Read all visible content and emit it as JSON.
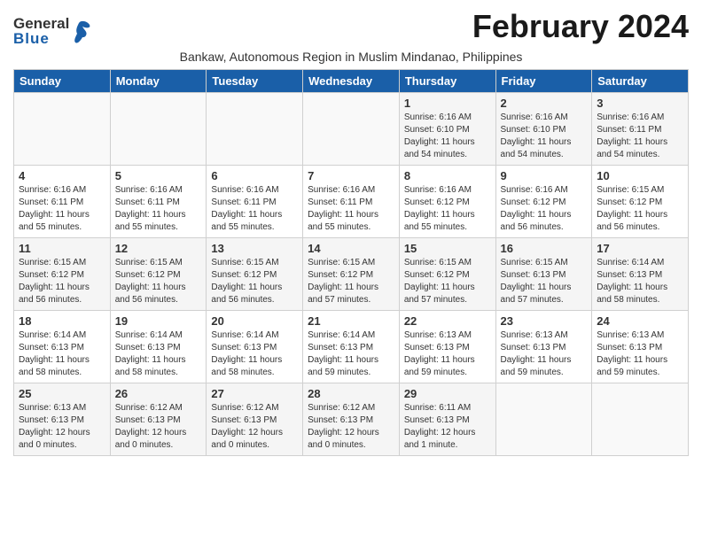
{
  "header": {
    "logo_general": "General",
    "logo_blue": "Blue",
    "month_title": "February 2024",
    "subtitle": "Bankaw, Autonomous Region in Muslim Mindanao, Philippines"
  },
  "weekdays": [
    "Sunday",
    "Monday",
    "Tuesday",
    "Wednesday",
    "Thursday",
    "Friday",
    "Saturday"
  ],
  "weeks": [
    [
      {
        "day": "",
        "info": ""
      },
      {
        "day": "",
        "info": ""
      },
      {
        "day": "",
        "info": ""
      },
      {
        "day": "",
        "info": ""
      },
      {
        "day": "1",
        "info": "Sunrise: 6:16 AM\nSunset: 6:10 PM\nDaylight: 11 hours\nand 54 minutes."
      },
      {
        "day": "2",
        "info": "Sunrise: 6:16 AM\nSunset: 6:10 PM\nDaylight: 11 hours\nand 54 minutes."
      },
      {
        "day": "3",
        "info": "Sunrise: 6:16 AM\nSunset: 6:11 PM\nDaylight: 11 hours\nand 54 minutes."
      }
    ],
    [
      {
        "day": "4",
        "info": "Sunrise: 6:16 AM\nSunset: 6:11 PM\nDaylight: 11 hours\nand 55 minutes."
      },
      {
        "day": "5",
        "info": "Sunrise: 6:16 AM\nSunset: 6:11 PM\nDaylight: 11 hours\nand 55 minutes."
      },
      {
        "day": "6",
        "info": "Sunrise: 6:16 AM\nSunset: 6:11 PM\nDaylight: 11 hours\nand 55 minutes."
      },
      {
        "day": "7",
        "info": "Sunrise: 6:16 AM\nSunset: 6:11 PM\nDaylight: 11 hours\nand 55 minutes."
      },
      {
        "day": "8",
        "info": "Sunrise: 6:16 AM\nSunset: 6:12 PM\nDaylight: 11 hours\nand 55 minutes."
      },
      {
        "day": "9",
        "info": "Sunrise: 6:16 AM\nSunset: 6:12 PM\nDaylight: 11 hours\nand 56 minutes."
      },
      {
        "day": "10",
        "info": "Sunrise: 6:15 AM\nSunset: 6:12 PM\nDaylight: 11 hours\nand 56 minutes."
      }
    ],
    [
      {
        "day": "11",
        "info": "Sunrise: 6:15 AM\nSunset: 6:12 PM\nDaylight: 11 hours\nand 56 minutes."
      },
      {
        "day": "12",
        "info": "Sunrise: 6:15 AM\nSunset: 6:12 PM\nDaylight: 11 hours\nand 56 minutes."
      },
      {
        "day": "13",
        "info": "Sunrise: 6:15 AM\nSunset: 6:12 PM\nDaylight: 11 hours\nand 56 minutes."
      },
      {
        "day": "14",
        "info": "Sunrise: 6:15 AM\nSunset: 6:12 PM\nDaylight: 11 hours\nand 57 minutes."
      },
      {
        "day": "15",
        "info": "Sunrise: 6:15 AM\nSunset: 6:12 PM\nDaylight: 11 hours\nand 57 minutes."
      },
      {
        "day": "16",
        "info": "Sunrise: 6:15 AM\nSunset: 6:13 PM\nDaylight: 11 hours\nand 57 minutes."
      },
      {
        "day": "17",
        "info": "Sunrise: 6:14 AM\nSunset: 6:13 PM\nDaylight: 11 hours\nand 58 minutes."
      }
    ],
    [
      {
        "day": "18",
        "info": "Sunrise: 6:14 AM\nSunset: 6:13 PM\nDaylight: 11 hours\nand 58 minutes."
      },
      {
        "day": "19",
        "info": "Sunrise: 6:14 AM\nSunset: 6:13 PM\nDaylight: 11 hours\nand 58 minutes."
      },
      {
        "day": "20",
        "info": "Sunrise: 6:14 AM\nSunset: 6:13 PM\nDaylight: 11 hours\nand 58 minutes."
      },
      {
        "day": "21",
        "info": "Sunrise: 6:14 AM\nSunset: 6:13 PM\nDaylight: 11 hours\nand 59 minutes."
      },
      {
        "day": "22",
        "info": "Sunrise: 6:13 AM\nSunset: 6:13 PM\nDaylight: 11 hours\nand 59 minutes."
      },
      {
        "day": "23",
        "info": "Sunrise: 6:13 AM\nSunset: 6:13 PM\nDaylight: 11 hours\nand 59 minutes."
      },
      {
        "day": "24",
        "info": "Sunrise: 6:13 AM\nSunset: 6:13 PM\nDaylight: 11 hours\nand 59 minutes."
      }
    ],
    [
      {
        "day": "25",
        "info": "Sunrise: 6:13 AM\nSunset: 6:13 PM\nDaylight: 12 hours\nand 0 minutes."
      },
      {
        "day": "26",
        "info": "Sunrise: 6:12 AM\nSunset: 6:13 PM\nDaylight: 12 hours\nand 0 minutes."
      },
      {
        "day": "27",
        "info": "Sunrise: 6:12 AM\nSunset: 6:13 PM\nDaylight: 12 hours\nand 0 minutes."
      },
      {
        "day": "28",
        "info": "Sunrise: 6:12 AM\nSunset: 6:13 PM\nDaylight: 12 hours\nand 0 minutes."
      },
      {
        "day": "29",
        "info": "Sunrise: 6:11 AM\nSunset: 6:13 PM\nDaylight: 12 hours\nand 1 minute."
      },
      {
        "day": "",
        "info": ""
      },
      {
        "day": "",
        "info": ""
      }
    ]
  ]
}
